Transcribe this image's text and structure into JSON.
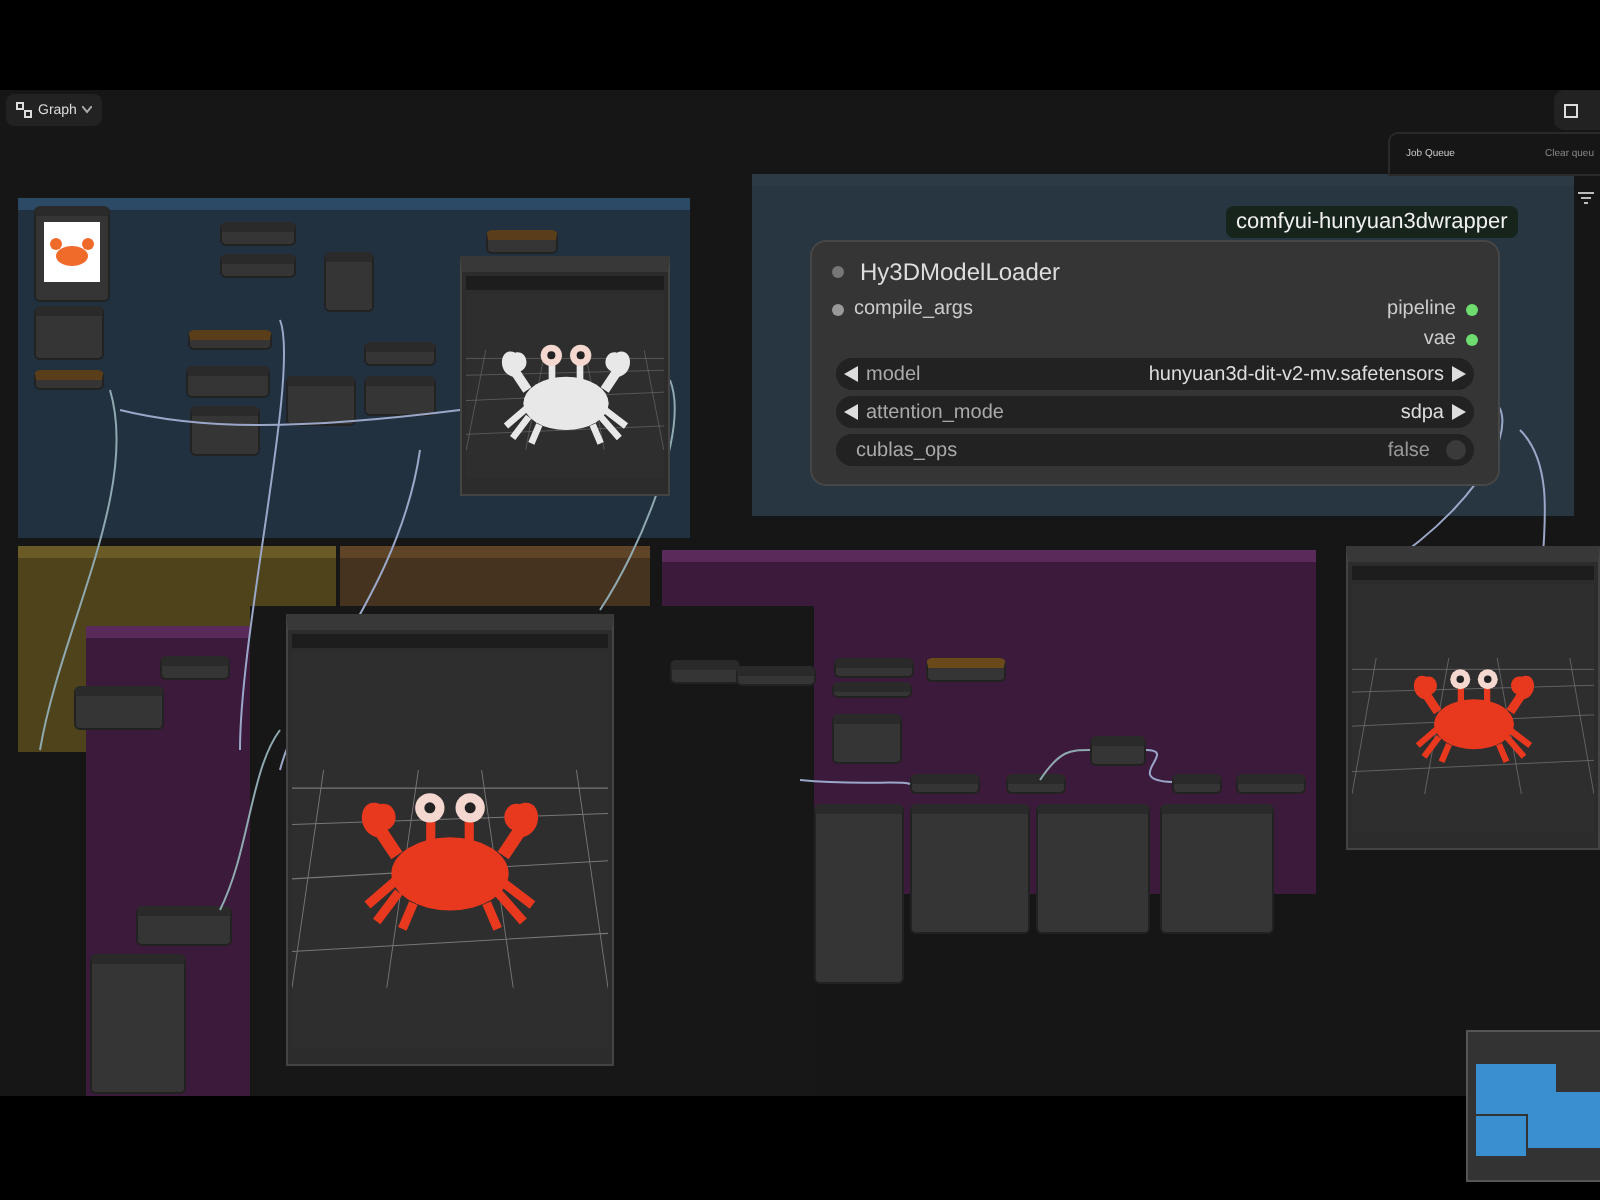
{
  "toolbar": {
    "graph_button": "Graph"
  },
  "job_queue": {
    "title": "Job Queue",
    "action": "Clear queu"
  },
  "badge": "comfyui-hunyuan3dwrapper",
  "model_loader": {
    "title": "Hy3DModelLoader",
    "inputs": [
      "compile_args"
    ],
    "outputs": [
      "pipeline",
      "vae"
    ],
    "widgets": [
      {
        "kind": "combo",
        "label": "model",
        "value": "hunyuan3d-dit-v2-mv.safetensors"
      },
      {
        "kind": "combo",
        "label": "attention_mode",
        "value": "sdpa"
      },
      {
        "kind": "toggle",
        "label": "cublas_ops",
        "value": "false",
        "on": false
      }
    ]
  }
}
